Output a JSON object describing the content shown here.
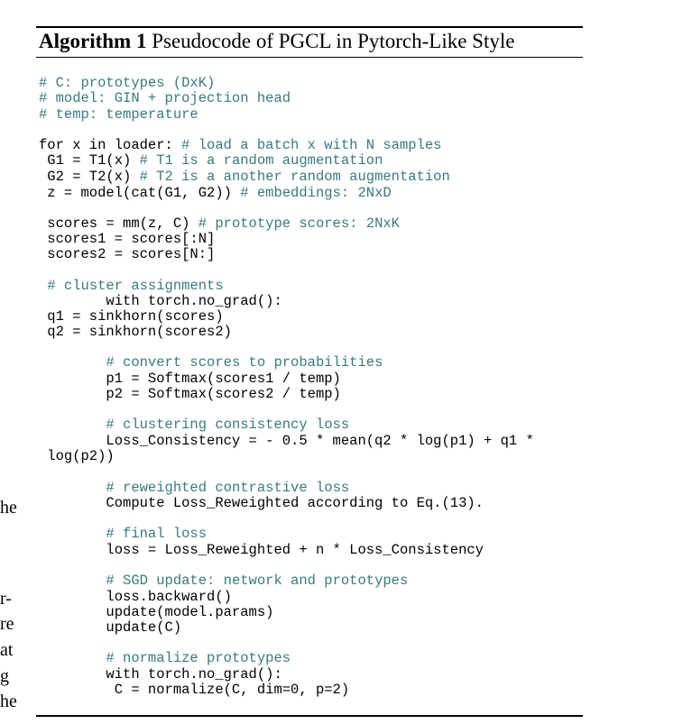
{
  "algorithm": {
    "label": "Algorithm 1",
    "title": "Pseudocode of PGCL in Pytorch-Like Style"
  },
  "colors": {
    "comment": "#3a7a80",
    "text": "#000000"
  },
  "lines": [
    {
      "code": "",
      "comment": "# C: prototypes (DxK)"
    },
    {
      "code": "",
      "comment": "# model: GIN + projection head"
    },
    {
      "code": "",
      "comment": "# temp: temperature"
    },
    {
      "code": "for x in loader: ",
      "comment": "# load a batch x with N samples"
    },
    {
      "code": " G1 = T1(x) ",
      "comment": "# T1 is a random augmentation"
    },
    {
      "code": " G2 = T2(x) ",
      "comment": "# T2 is a another random augmentation"
    },
    {
      "code": " z = model(cat(G1, G2)) ",
      "comment": "# embeddings: 2NxD"
    },
    {
      "code": " scores = mm(z, C) ",
      "comment": "# prototype scores: 2NxK"
    },
    {
      "code": " scores1 = scores[:N]",
      "comment": ""
    },
    {
      "code": " scores2 = scores[N:]",
      "comment": ""
    },
    {
      "code": " ",
      "comment": "# cluster assignments"
    },
    {
      "code": "        with torch.no_grad():",
      "comment": ""
    },
    {
      "code": " q1 = sinkhorn(scores)",
      "comment": ""
    },
    {
      "code": " q2 = sinkhorn(scores2)",
      "comment": ""
    },
    {
      "code": "        ",
      "comment": "# convert scores to probabilities"
    },
    {
      "code": "        p1 = Softmax(scores1 / temp)",
      "comment": ""
    },
    {
      "code": "        p2 = Softmax(scores2 / temp)",
      "comment": ""
    },
    {
      "code": "        ",
      "comment": "# clustering consistency loss"
    },
    {
      "code": "        Loss_Consistency = - 0.5 * mean(q2 * log(p1) + q1 *",
      "comment": ""
    },
    {
      "code": " log(p2))",
      "comment": ""
    },
    {
      "code": "        ",
      "comment": "# reweighted contrastive loss"
    },
    {
      "code": "        Compute Loss_Reweighted according to Eq.(13).",
      "comment": ""
    },
    {
      "code": "        ",
      "comment": "# final loss"
    },
    {
      "code": "        loss = Loss_Reweighted + n * Loss_Consistency",
      "comment": ""
    },
    {
      "code": "        ",
      "comment": "# SGD update: network and prototypes"
    },
    {
      "code": "        loss.backward()",
      "comment": ""
    },
    {
      "code": "        update(model.params)",
      "comment": ""
    },
    {
      "code": "        update(C)",
      "comment": ""
    },
    {
      "code": "        ",
      "comment": "# normalize prototypes"
    },
    {
      "code": "        with torch.no_grad():",
      "comment": ""
    },
    {
      "code": "         C = normalize(C, dim=0, p=2)",
      "comment": ""
    }
  ],
  "margin_fragments": [
    "he",
    "r-",
    "re",
    "at",
    "g",
    "he"
  ]
}
